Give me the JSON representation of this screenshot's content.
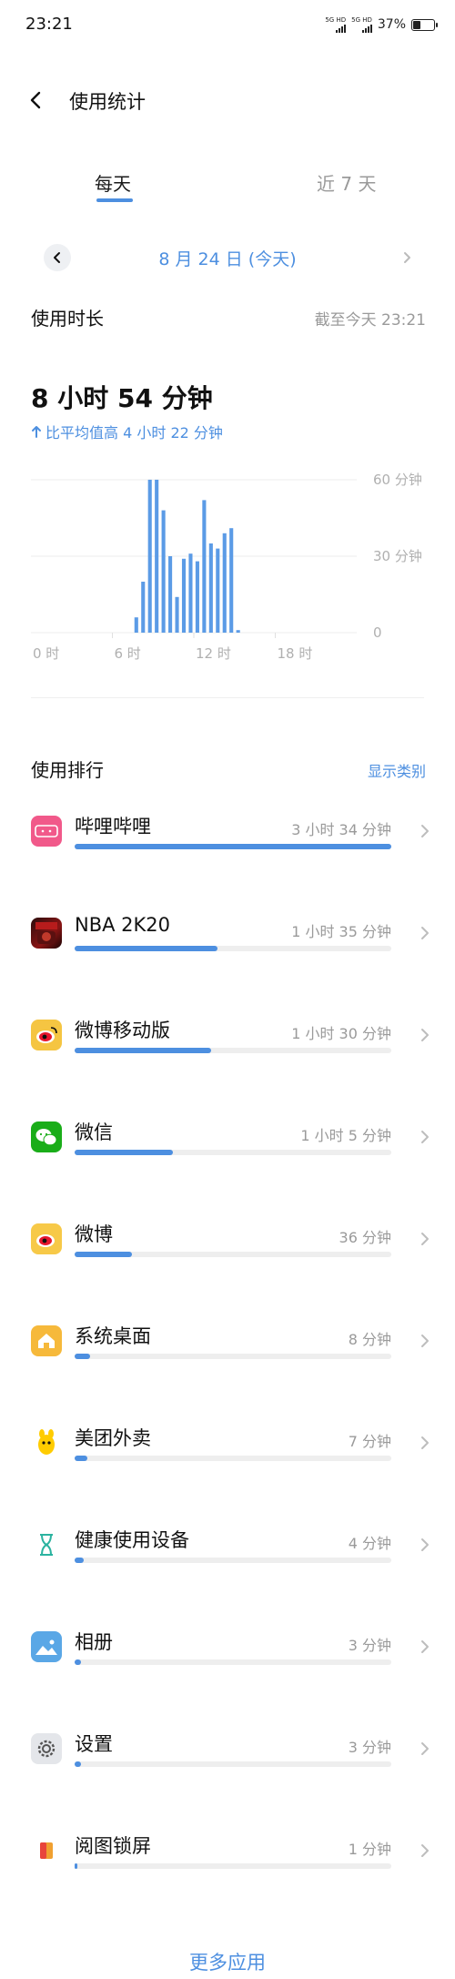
{
  "status_bar": {
    "time": "23:21",
    "sim1_label": "5G HD",
    "sim2_label": "5G HD",
    "battery_text": "37%",
    "battery_level": 0.37
  },
  "header": {
    "title": "使用统计"
  },
  "tabs": [
    {
      "label": "每天",
      "active": true
    },
    {
      "label": "近 7 天",
      "active": false
    }
  ],
  "date_nav": {
    "label": "8 月 24 日 (今天)"
  },
  "usage": {
    "title": "使用时长",
    "as_of": "截至今天 23:21",
    "total": "8 小时 54 分钟",
    "compare": "比平均值高 4 小时 22 分钟"
  },
  "chart_data": {
    "type": "bar",
    "unit": "分钟",
    "x_tick_labels": [
      "0 时",
      "6 时",
      "12 时",
      "18 时"
    ],
    "y_tick_labels": [
      "60 分钟",
      "30 分钟",
      "0"
    ],
    "ylim": [
      0,
      60
    ],
    "grid": true,
    "bar_color": "#5b9be6",
    "slots": 48,
    "values": [
      0,
      0,
      0,
      0,
      0,
      0,
      0,
      0,
      0,
      0,
      0,
      0,
      0,
      0,
      0,
      0,
      0,
      0,
      0,
      0,
      0,
      0,
      0,
      0,
      0,
      0,
      0,
      0,
      0,
      0,
      0,
      0,
      0,
      0,
      0,
      0,
      0,
      0,
      0,
      0,
      0,
      0,
      0,
      0,
      0,
      0,
      0,
      0
    ],
    "bars": [
      {
        "slot": 15,
        "value": 6
      },
      {
        "slot": 16,
        "value": 20
      },
      {
        "slot": 17,
        "value": 60
      },
      {
        "slot": 18,
        "value": 60
      },
      {
        "slot": 19,
        "value": 48
      },
      {
        "slot": 20,
        "value": 30
      },
      {
        "slot": 21,
        "value": 14
      },
      {
        "slot": 22,
        "value": 29
      },
      {
        "slot": 23,
        "value": 31
      },
      {
        "slot": 24,
        "value": 28
      },
      {
        "slot": 25,
        "value": 52
      },
      {
        "slot": 26,
        "value": 35
      },
      {
        "slot": 27,
        "value": 33
      },
      {
        "slot": 28,
        "value": 39
      },
      {
        "slot": 29,
        "value": 41
      },
      {
        "slot": 30,
        "value": 1
      }
    ]
  },
  "ranking": {
    "title": "使用排行",
    "toggle": "显示类别",
    "accent_color": "#4d8fe0",
    "apps": [
      {
        "name": "哔哩哔哩",
        "time": "3 小时 34 分钟",
        "fraction": 1.0,
        "icon": "bilibili-icon"
      },
      {
        "name": "NBA 2K20",
        "time": "1 小时 35 分钟",
        "fraction": 0.45,
        "icon": "nba2k20-icon"
      },
      {
        "name": "微博移动版",
        "time": "1 小时 30 分钟",
        "fraction": 0.43,
        "icon": "weibo-lite-icon"
      },
      {
        "name": "微信",
        "time": "1 小时 5 分钟",
        "fraction": 0.31,
        "icon": "wechat-icon"
      },
      {
        "name": "微博",
        "time": "36 分钟",
        "fraction": 0.18,
        "icon": "weibo-icon"
      },
      {
        "name": "系统桌面",
        "time": "8 分钟",
        "fraction": 0.05,
        "icon": "home-launcher-icon"
      },
      {
        "name": "美团外卖",
        "time": "7 分钟",
        "fraction": 0.04,
        "icon": "meituan-icon"
      },
      {
        "name": "健康使用设备",
        "time": "4 分钟",
        "fraction": 0.03,
        "icon": "hourglass-icon"
      },
      {
        "name": "相册",
        "time": "3 分钟",
        "fraction": 0.02,
        "icon": "gallery-icon"
      },
      {
        "name": "设置",
        "time": "3 分钟",
        "fraction": 0.02,
        "icon": "settings-icon"
      },
      {
        "name": "阅图锁屏",
        "time": "1 分钟",
        "fraction": 0.01,
        "icon": "lockscreen-icon"
      }
    ],
    "more": "更多应用"
  }
}
